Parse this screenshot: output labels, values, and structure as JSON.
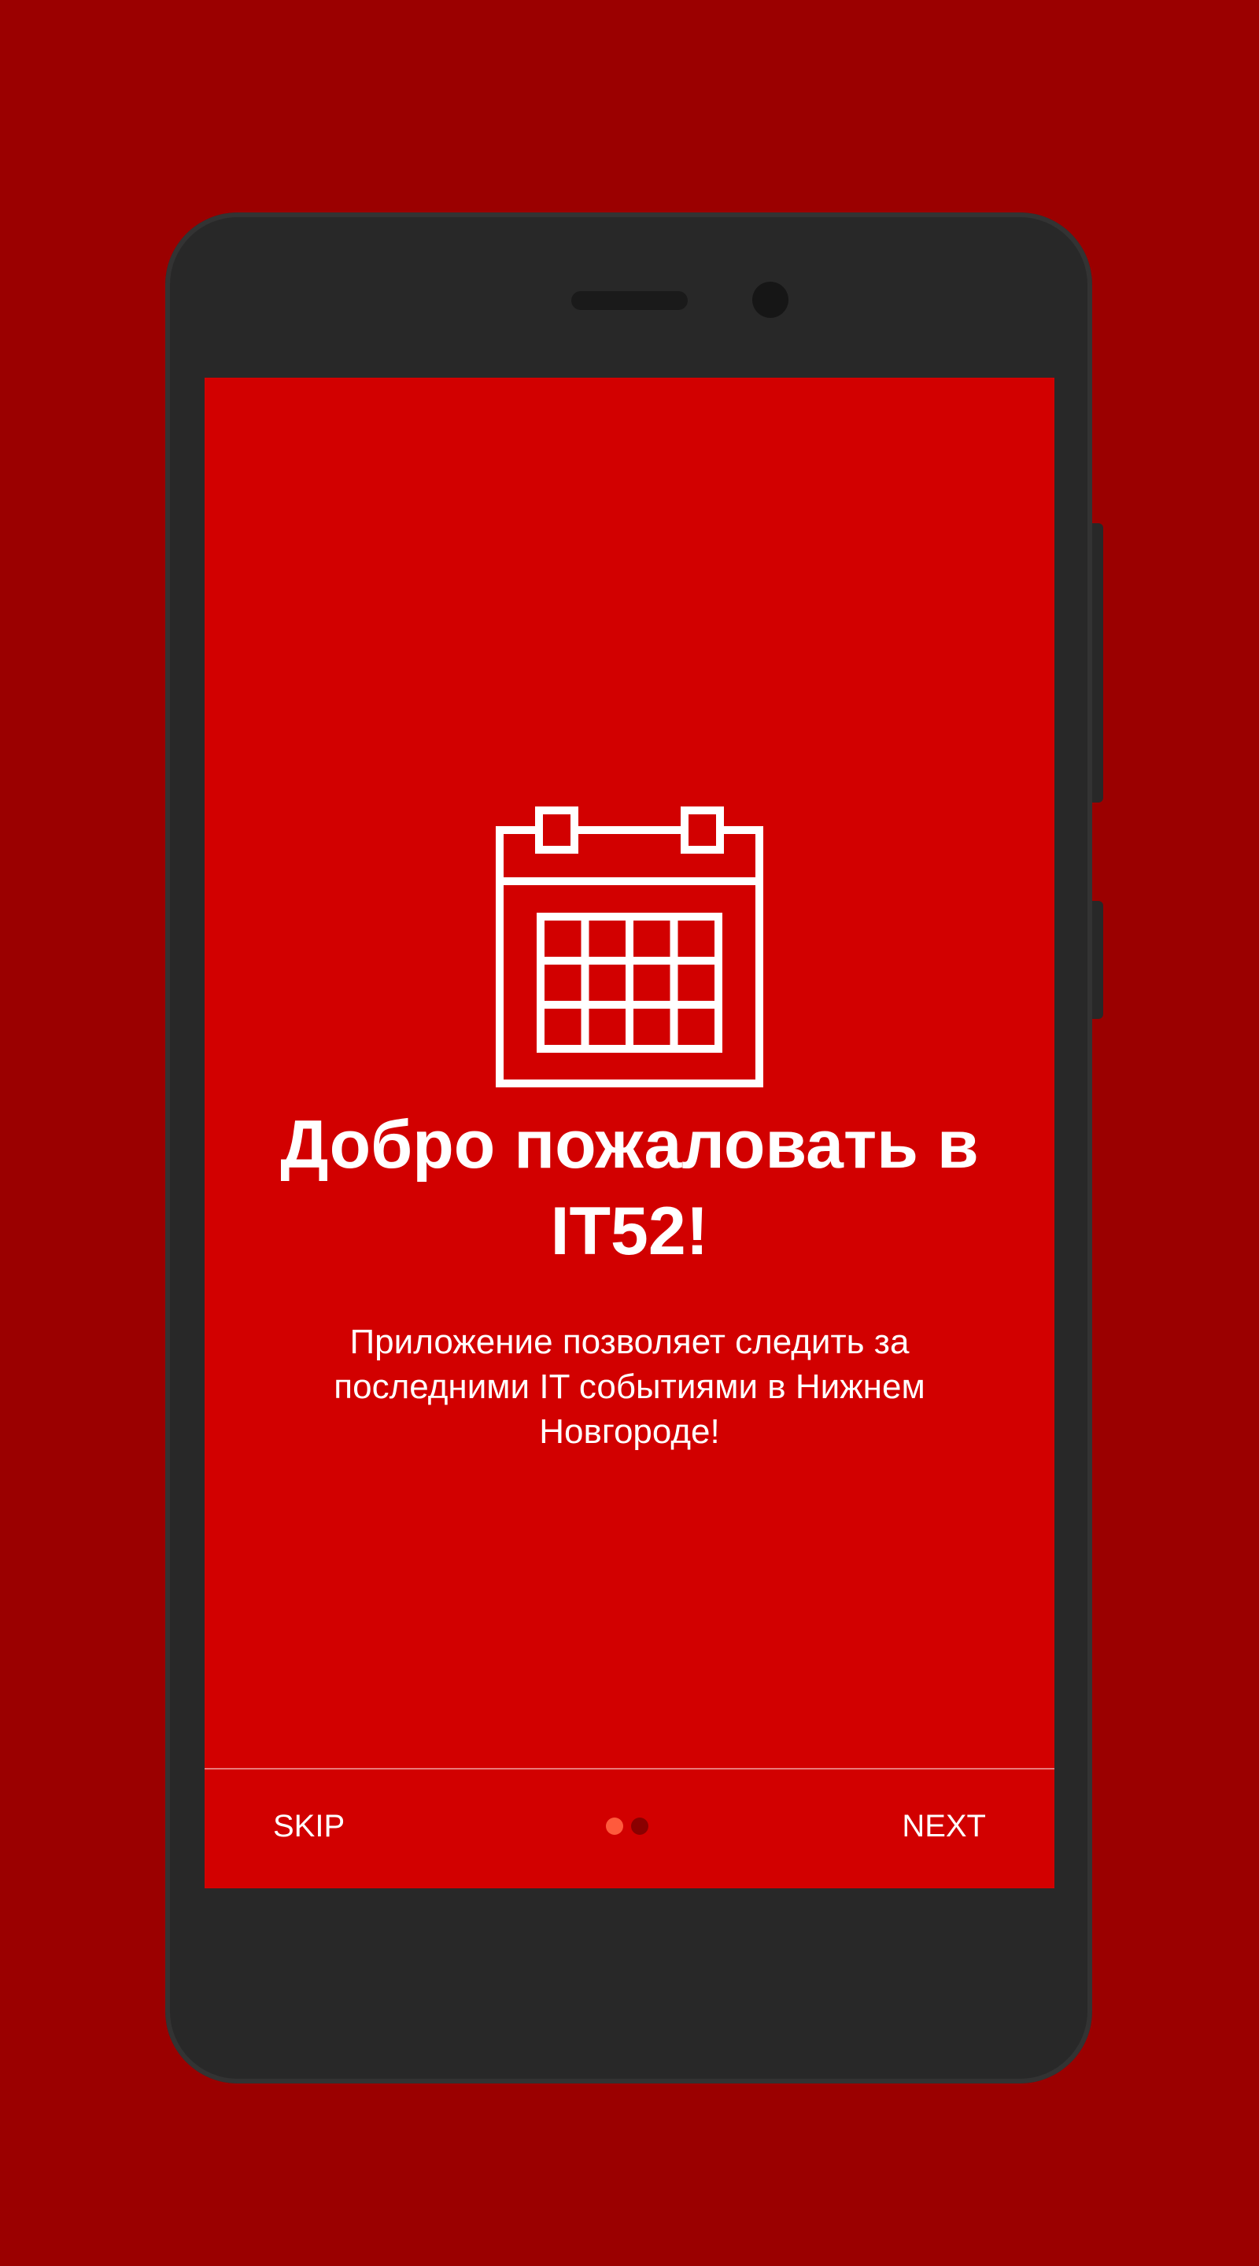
{
  "onboarding": {
    "title": "Добро пожаловать в IT52!",
    "description": "Приложение позволяет следить за последними IT событиями в Нижнем Новгороде!",
    "icon": "calendar-icon",
    "skip_label": "SKIP",
    "next_label": "NEXT",
    "pages_total": 2,
    "current_page": 1
  },
  "colors": {
    "background": "#9b0000",
    "screen": "#d20000",
    "phone_body": "#282828",
    "text": "#ffffff",
    "dot_active": "#ff5a3c",
    "dot_inactive": "#8a0000"
  }
}
